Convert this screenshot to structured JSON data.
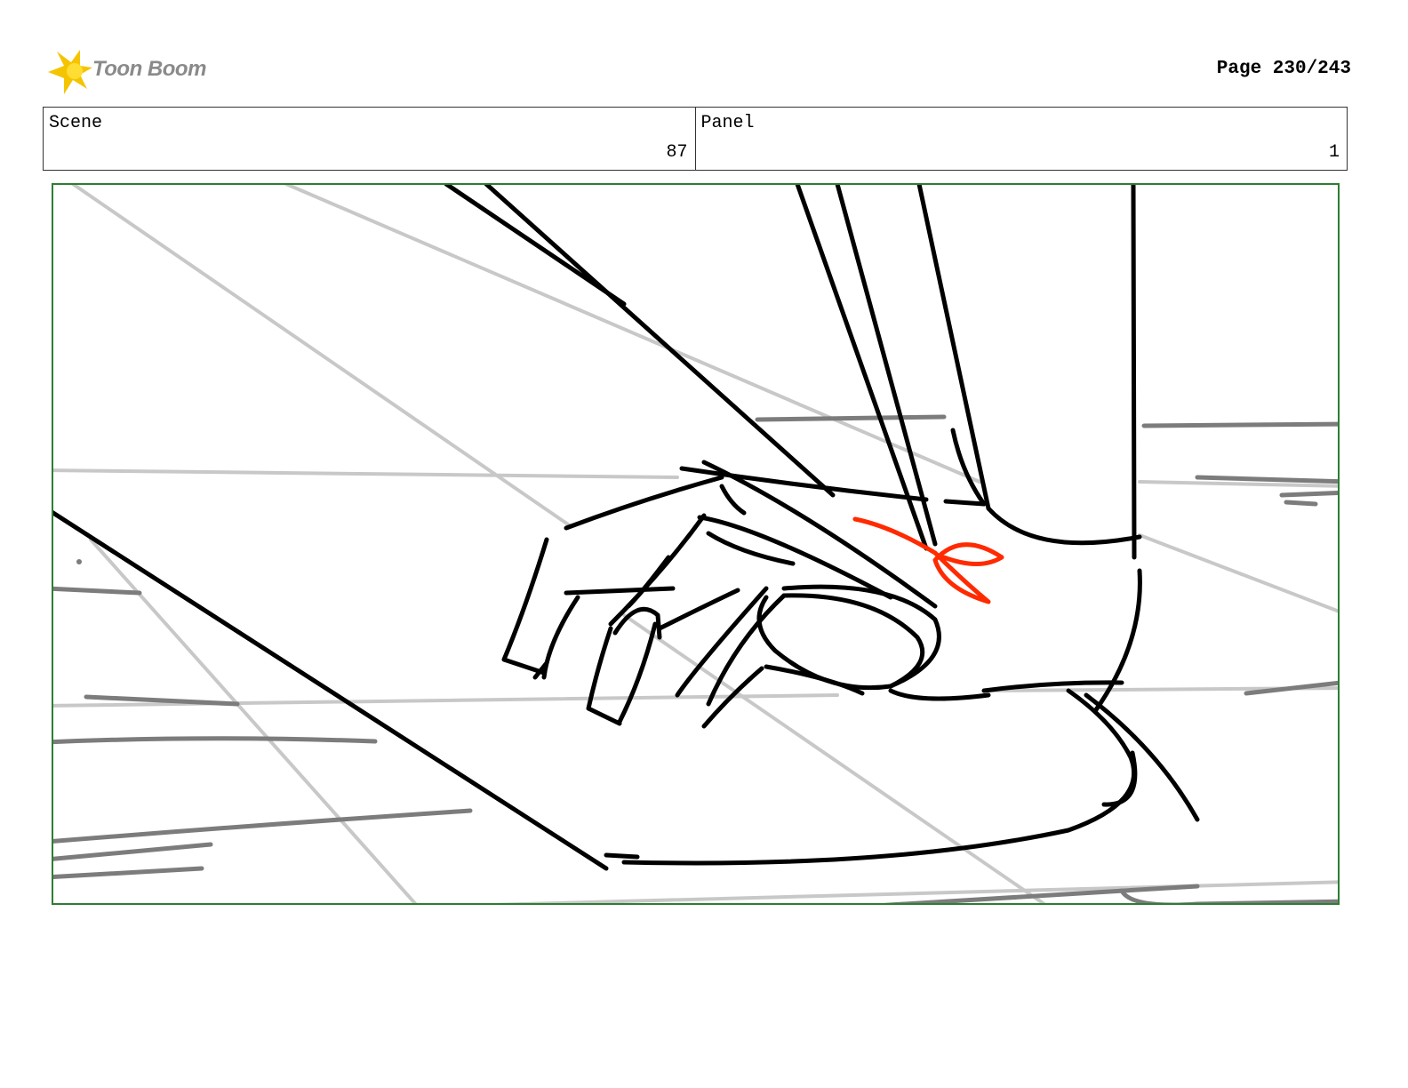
{
  "header": {
    "logo_text": "Toon Boom",
    "page_label": "Page 230/243"
  },
  "info": {
    "scene_label": "Scene",
    "scene_value": "87",
    "panel_label": "Panel",
    "panel_value": "1"
  },
  "colors": {
    "panel_border": "#2e7d32",
    "accent_red": "#ff2a00",
    "logo_star": "#f5c400"
  }
}
